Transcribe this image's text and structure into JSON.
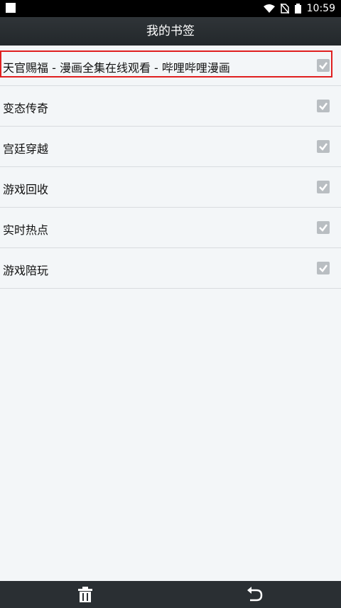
{
  "status_bar": {
    "time": "10:59",
    "icons": [
      "wifi-icon",
      "no-sim-icon",
      "battery-icon"
    ]
  },
  "header": {
    "title": "我的书签"
  },
  "bookmarks": [
    {
      "label": "天官赐福 - 漫画全集在线观看 - 哔哩哔哩漫画",
      "checked": true,
      "selected": true
    },
    {
      "label": "变态传奇",
      "checked": true
    },
    {
      "label": "宫廷穿越",
      "checked": true
    },
    {
      "label": "游戏回收",
      "checked": true
    },
    {
      "label": "实时热点",
      "checked": true
    },
    {
      "label": "游戏陪玩",
      "checked": true
    }
  ],
  "bottom_bar": {
    "buttons": [
      "delete-icon",
      "back-icon"
    ]
  },
  "colors": {
    "highlight": "#e02020",
    "titlebar": "#2b3034",
    "background": "#f3f6f8"
  }
}
